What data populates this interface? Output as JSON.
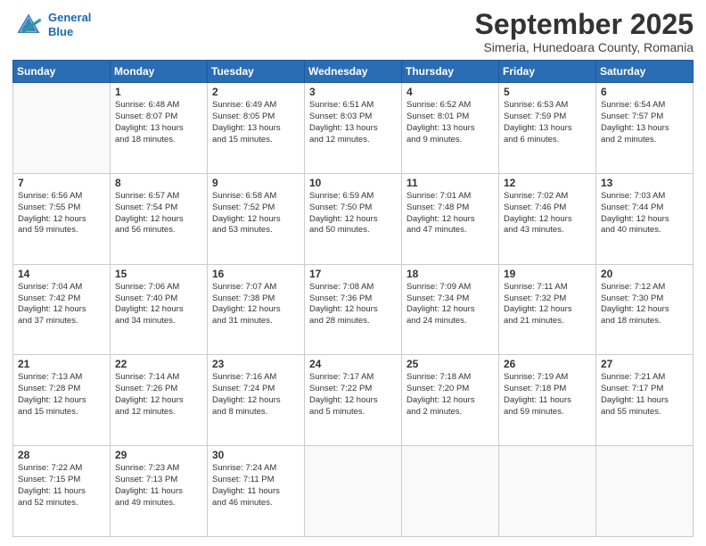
{
  "header": {
    "logo_line1": "General",
    "logo_line2": "Blue",
    "month": "September 2025",
    "location": "Simeria, Hunedoara County, Romania"
  },
  "days_of_week": [
    "Sunday",
    "Monday",
    "Tuesday",
    "Wednesday",
    "Thursday",
    "Friday",
    "Saturday"
  ],
  "weeks": [
    [
      {
        "day": "",
        "info": ""
      },
      {
        "day": "1",
        "info": "Sunrise: 6:48 AM\nSunset: 8:07 PM\nDaylight: 13 hours\nand 18 minutes."
      },
      {
        "day": "2",
        "info": "Sunrise: 6:49 AM\nSunset: 8:05 PM\nDaylight: 13 hours\nand 15 minutes."
      },
      {
        "day": "3",
        "info": "Sunrise: 6:51 AM\nSunset: 8:03 PM\nDaylight: 13 hours\nand 12 minutes."
      },
      {
        "day": "4",
        "info": "Sunrise: 6:52 AM\nSunset: 8:01 PM\nDaylight: 13 hours\nand 9 minutes."
      },
      {
        "day": "5",
        "info": "Sunrise: 6:53 AM\nSunset: 7:59 PM\nDaylight: 13 hours\nand 6 minutes."
      },
      {
        "day": "6",
        "info": "Sunrise: 6:54 AM\nSunset: 7:57 PM\nDaylight: 13 hours\nand 2 minutes."
      }
    ],
    [
      {
        "day": "7",
        "info": "Sunrise: 6:56 AM\nSunset: 7:55 PM\nDaylight: 12 hours\nand 59 minutes."
      },
      {
        "day": "8",
        "info": "Sunrise: 6:57 AM\nSunset: 7:54 PM\nDaylight: 12 hours\nand 56 minutes."
      },
      {
        "day": "9",
        "info": "Sunrise: 6:58 AM\nSunset: 7:52 PM\nDaylight: 12 hours\nand 53 minutes."
      },
      {
        "day": "10",
        "info": "Sunrise: 6:59 AM\nSunset: 7:50 PM\nDaylight: 12 hours\nand 50 minutes."
      },
      {
        "day": "11",
        "info": "Sunrise: 7:01 AM\nSunset: 7:48 PM\nDaylight: 12 hours\nand 47 minutes."
      },
      {
        "day": "12",
        "info": "Sunrise: 7:02 AM\nSunset: 7:46 PM\nDaylight: 12 hours\nand 43 minutes."
      },
      {
        "day": "13",
        "info": "Sunrise: 7:03 AM\nSunset: 7:44 PM\nDaylight: 12 hours\nand 40 minutes."
      }
    ],
    [
      {
        "day": "14",
        "info": "Sunrise: 7:04 AM\nSunset: 7:42 PM\nDaylight: 12 hours\nand 37 minutes."
      },
      {
        "day": "15",
        "info": "Sunrise: 7:06 AM\nSunset: 7:40 PM\nDaylight: 12 hours\nand 34 minutes."
      },
      {
        "day": "16",
        "info": "Sunrise: 7:07 AM\nSunset: 7:38 PM\nDaylight: 12 hours\nand 31 minutes."
      },
      {
        "day": "17",
        "info": "Sunrise: 7:08 AM\nSunset: 7:36 PM\nDaylight: 12 hours\nand 28 minutes."
      },
      {
        "day": "18",
        "info": "Sunrise: 7:09 AM\nSunset: 7:34 PM\nDaylight: 12 hours\nand 24 minutes."
      },
      {
        "day": "19",
        "info": "Sunrise: 7:11 AM\nSunset: 7:32 PM\nDaylight: 12 hours\nand 21 minutes."
      },
      {
        "day": "20",
        "info": "Sunrise: 7:12 AM\nSunset: 7:30 PM\nDaylight: 12 hours\nand 18 minutes."
      }
    ],
    [
      {
        "day": "21",
        "info": "Sunrise: 7:13 AM\nSunset: 7:28 PM\nDaylight: 12 hours\nand 15 minutes."
      },
      {
        "day": "22",
        "info": "Sunrise: 7:14 AM\nSunset: 7:26 PM\nDaylight: 12 hours\nand 12 minutes."
      },
      {
        "day": "23",
        "info": "Sunrise: 7:16 AM\nSunset: 7:24 PM\nDaylight: 12 hours\nand 8 minutes."
      },
      {
        "day": "24",
        "info": "Sunrise: 7:17 AM\nSunset: 7:22 PM\nDaylight: 12 hours\nand 5 minutes."
      },
      {
        "day": "25",
        "info": "Sunrise: 7:18 AM\nSunset: 7:20 PM\nDaylight: 12 hours\nand 2 minutes."
      },
      {
        "day": "26",
        "info": "Sunrise: 7:19 AM\nSunset: 7:18 PM\nDaylight: 11 hours\nand 59 minutes."
      },
      {
        "day": "27",
        "info": "Sunrise: 7:21 AM\nSunset: 7:17 PM\nDaylight: 11 hours\nand 55 minutes."
      }
    ],
    [
      {
        "day": "28",
        "info": "Sunrise: 7:22 AM\nSunset: 7:15 PM\nDaylight: 11 hours\nand 52 minutes."
      },
      {
        "day": "29",
        "info": "Sunrise: 7:23 AM\nSunset: 7:13 PM\nDaylight: 11 hours\nand 49 minutes."
      },
      {
        "day": "30",
        "info": "Sunrise: 7:24 AM\nSunset: 7:11 PM\nDaylight: 11 hours\nand 46 minutes."
      },
      {
        "day": "",
        "info": ""
      },
      {
        "day": "",
        "info": ""
      },
      {
        "day": "",
        "info": ""
      },
      {
        "day": "",
        "info": ""
      }
    ]
  ]
}
